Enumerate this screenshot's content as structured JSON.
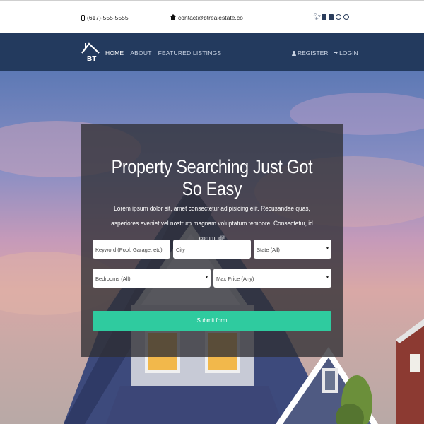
{
  "topbar": {
    "phone": "(617)-555-5555",
    "email": "contact@btrealestate.co",
    "social_icons": [
      "twitter-icon",
      "facebook-icon",
      "linkedin-icon",
      "instagram-icon",
      "pinterest-icon"
    ]
  },
  "navbar": {
    "logo_text": "BT",
    "links": [
      {
        "label": "HOME",
        "active": true
      },
      {
        "label": "ABOUT",
        "active": false
      },
      {
        "label": "FEATURED LISTINGS",
        "active": false
      }
    ],
    "register_label": "REGISTER",
    "login_label": "LOGIN"
  },
  "hero": {
    "title": "Property Searching Just Got So Easy",
    "text": "Lorem ipsum dolor sit, amet consectetur adipisicing elit. Recusandae quas, asperiores eveniet vel nostrum magnam voluptatum tempore! Consectetur, id commodi!"
  },
  "search": {
    "keyword_placeholder": "Keyword (Pool, Garage, etc)",
    "city_placeholder": "City",
    "state_value": "State (All)",
    "bedrooms_value": "Bedrooms (All)",
    "max_price_value": "Max Price (Any)",
    "submit_label": "Submit form"
  },
  "colors": {
    "navbar": "#233a5e",
    "submit": "#2fcb9f",
    "panel": "#303034"
  }
}
